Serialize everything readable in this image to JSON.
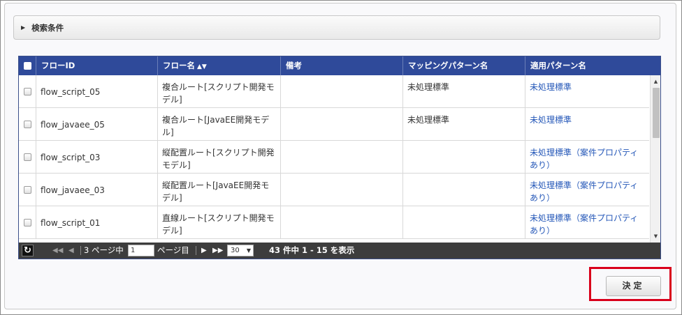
{
  "search": {
    "toggle_label": "検索条件"
  },
  "table": {
    "columns": [
      {
        "key": "flow_id",
        "label": "フローID"
      },
      {
        "key": "flow_name",
        "label": "フロー名",
        "sortable": true
      },
      {
        "key": "remarks",
        "label": "備考"
      },
      {
        "key": "mapping_pattern",
        "label": "マッピングパターン名"
      },
      {
        "key": "applied_pattern",
        "label": "適用パターン名"
      }
    ],
    "rows": [
      {
        "flow_id": "flow_script_05",
        "flow_name": "複合ルート[スクリプト開発モデル]",
        "remarks": "",
        "mapping_pattern": "未処理標準",
        "applied_pattern": "未処理標準"
      },
      {
        "flow_id": "flow_javaee_05",
        "flow_name": "複合ルート[JavaEE開発モデル]",
        "remarks": "",
        "mapping_pattern": "未処理標準",
        "applied_pattern": "未処理標準"
      },
      {
        "flow_id": "flow_script_03",
        "flow_name": "縦配置ルート[スクリプト開発モデル]",
        "remarks": "",
        "mapping_pattern": "",
        "applied_pattern": "未処理標準（案件プロパティあり）"
      },
      {
        "flow_id": "flow_javaee_03",
        "flow_name": "縦配置ルート[JavaEE開発モデル]",
        "remarks": "",
        "mapping_pattern": "",
        "applied_pattern": "未処理標準（案件プロパティあり）"
      },
      {
        "flow_id": "flow_script_01",
        "flow_name": "直線ルート[スクリプト開発モデル]",
        "remarks": "",
        "mapping_pattern": "",
        "applied_pattern": "未処理標準（案件プロパティあり）"
      }
    ]
  },
  "pager": {
    "total_pages_prefix": "3 ページ中",
    "current_page": "1",
    "page_suffix": "ページ目",
    "rows_per_page": "30",
    "summary": "43 件中 1 - 15 を表示"
  },
  "actions": {
    "decide_label": "決定"
  },
  "colors": {
    "header_bg": "#2f4a9a",
    "link": "#2457b8",
    "highlight": "#d9001b"
  }
}
